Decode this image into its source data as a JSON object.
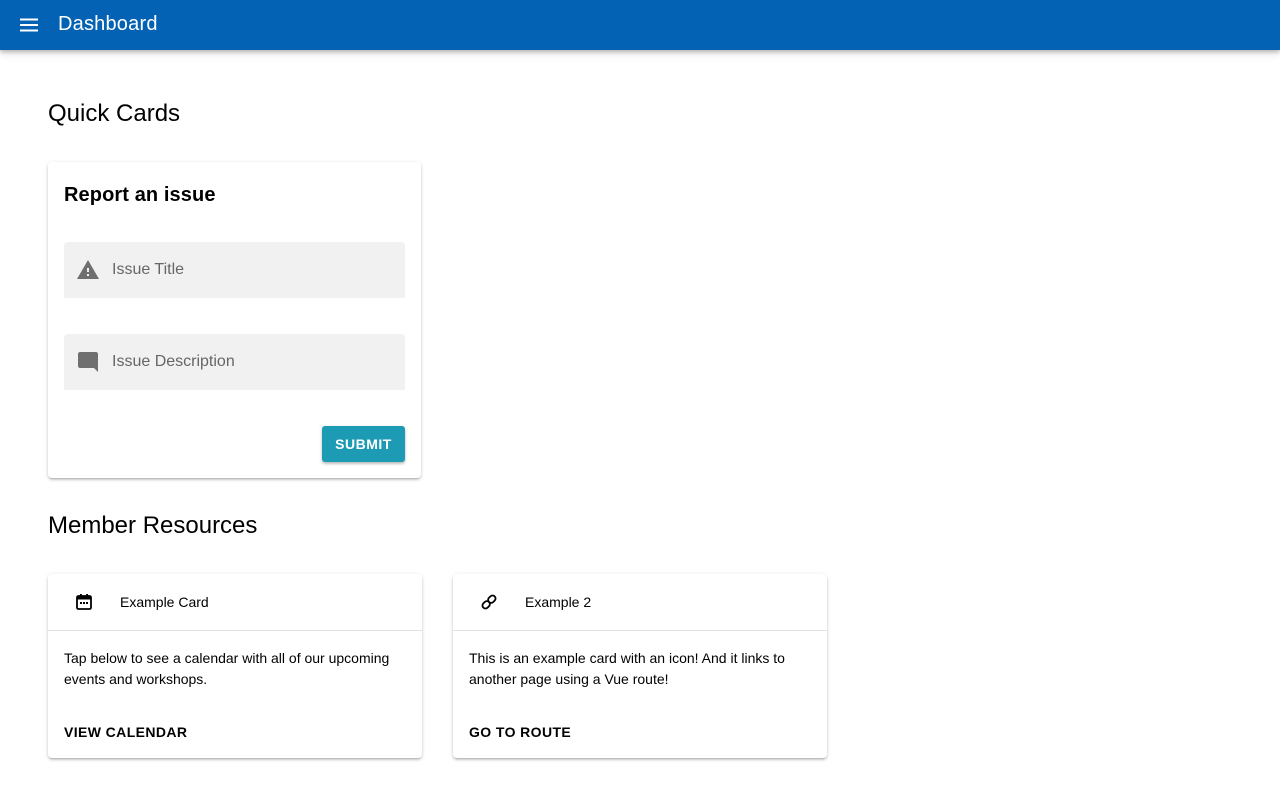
{
  "app_bar": {
    "title": "Dashboard",
    "menu_icon": "menu-icon",
    "background": "#0362b3"
  },
  "sections": {
    "quick_cards_title": "Quick Cards",
    "member_resources_title": "Member Resources"
  },
  "issue_card": {
    "title": "Report an issue",
    "issue_title_field": {
      "icon": "warning-icon",
      "placeholder": "Issue Title",
      "value": ""
    },
    "issue_description_field": {
      "icon": "comment-icon",
      "placeholder": "Issue Description",
      "value": ""
    },
    "submit_label": "SUBMIT",
    "submit_color": "#1d9ab4"
  },
  "resource_cards": [
    {
      "icon": "calendar-icon",
      "title": "Example Card",
      "body": "Tap below to see a calendar with all of our upcoming events and workshops.",
      "action_label": "VIEW CALENDAR"
    },
    {
      "icon": "link-icon",
      "title": "Example 2",
      "body": "This is an example card with an icon! And it links to another page using a Vue route!",
      "action_label": "GO TO ROUTE"
    }
  ]
}
